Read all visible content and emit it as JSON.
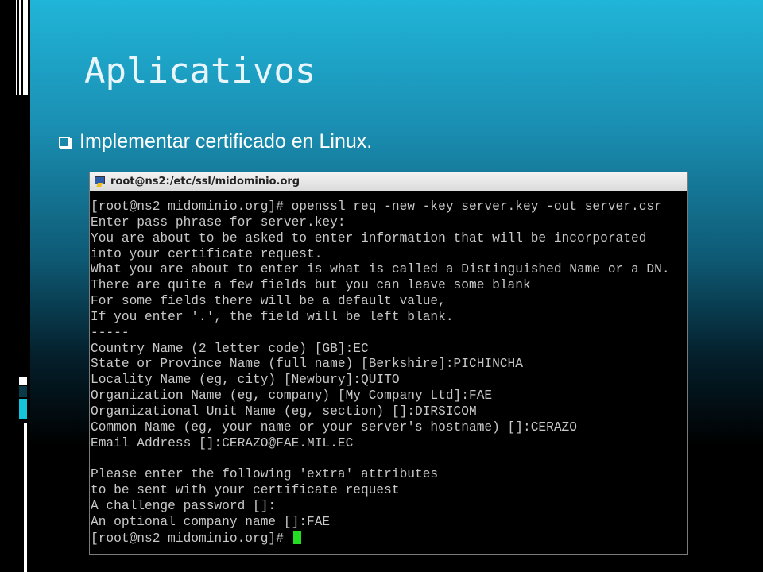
{
  "slide": {
    "title": "Aplicativos",
    "bullet": "Implementar certificado en Linux.",
    "bullet_icon": "hollow-square-bullet-icon"
  },
  "terminal": {
    "window_title": "root@ns2:/etc/ssl/midominio.org",
    "app_icon": "putty-icon",
    "lines": [
      "[root@ns2 midominio.org]# openssl req -new -key server.key -out server.csr",
      "Enter pass phrase for server.key:",
      "You are about to be asked to enter information that will be incorporated",
      "into your certificate request.",
      "What you are about to enter is what is called a Distinguished Name or a DN.",
      "There are quite a few fields but you can leave some blank",
      "For some fields there will be a default value,",
      "If you enter '.', the field will be left blank.",
      "-----",
      "Country Name (2 letter code) [GB]:EC",
      "State or Province Name (full name) [Berkshire]:PICHINCHA",
      "Locality Name (eg, city) [Newbury]:QUITO",
      "Organization Name (eg, company) [My Company Ltd]:FAE",
      "Organizational Unit Name (eg, section) []:DIRSICOM",
      "Common Name (eg, your name or your server's hostname) []:CERAZO",
      "Email Address []:CERAZO@FAE.MIL.EC",
      "",
      "Please enter the following 'extra' attributes",
      "to be sent with your certificate request",
      "A challenge password []:",
      "An optional company name []:FAE"
    ],
    "prompt": "[root@ns2 midominio.org]# "
  },
  "colors": {
    "background_top": "#20b5d8",
    "background_bottom": "#000000",
    "terminal_text": "#c8c8c8",
    "cursor": "#22dd22"
  }
}
